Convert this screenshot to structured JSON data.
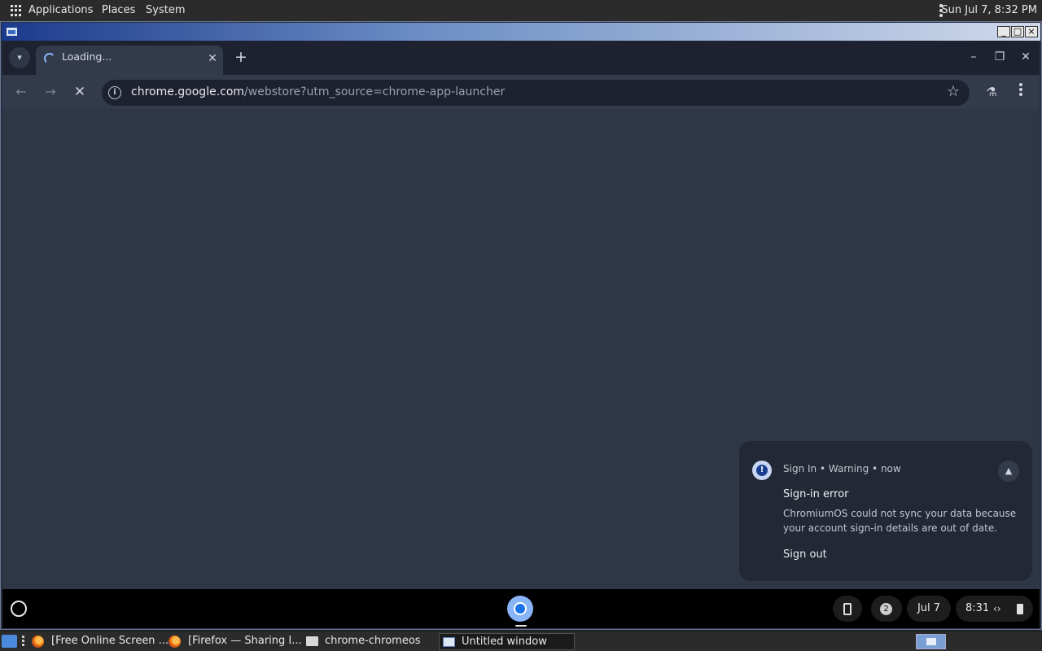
{
  "top_panel": {
    "menus": [
      "Applications",
      "Places",
      "System"
    ],
    "clock": "Sun Jul  7,  8:32 PM"
  },
  "xwindow": {
    "buttons": {
      "minimize": "_",
      "maximize": "□",
      "close": "×"
    }
  },
  "browser": {
    "tab": {
      "title": "Loading..."
    },
    "omnibox": {
      "url_host": "chrome.google.com",
      "url_rest": "/webstore?utm_source=chrome-app-launcher"
    }
  },
  "notification": {
    "source": "Sign In",
    "level": "Warning",
    "time": "now",
    "title": "Sign-in error",
    "body": "ChromiumOS could not sync your data because your account sign-in details are out of date.",
    "action": "Sign out"
  },
  "shelf": {
    "notification_count": "2",
    "date": "Jul 7",
    "time": "8:31"
  },
  "taskbar": {
    "items": [
      {
        "label": "[Free Online Screen ...",
        "icon": "firefox-icon"
      },
      {
        "label": "[Firefox — Sharing I...",
        "icon": "firefox-icon"
      },
      {
        "label": "chrome-chromeos",
        "icon": "folder-icon"
      },
      {
        "label": "Untitled window",
        "icon": "window-icon"
      }
    ]
  },
  "colors": {
    "accent": "#8ab4f8",
    "browser_bg": "#2f3646",
    "shelf_bg": "#000000"
  }
}
